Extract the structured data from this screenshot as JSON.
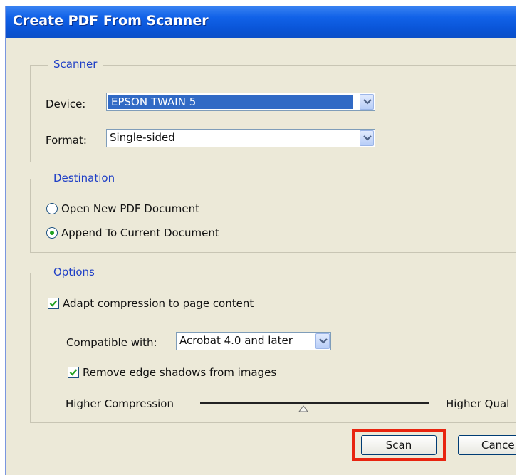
{
  "window": {
    "title": "Create PDF From Scanner"
  },
  "scanner": {
    "legend": "Scanner",
    "device_label": "Device:",
    "device_value": "EPSON TWAIN 5",
    "format_label": "Format:",
    "format_value": "Single-sided"
  },
  "destination": {
    "legend": "Destination",
    "options": [
      {
        "label": "Open New PDF Document",
        "selected": false
      },
      {
        "label": "Append To Current Document",
        "selected": true
      }
    ]
  },
  "options": {
    "legend": "Options",
    "adapt_compression": {
      "label": "Adapt compression to page content",
      "checked": true
    },
    "compatible_label": "Compatible with:",
    "compatible_value": "Acrobat 4.0 and later",
    "remove_shadows": {
      "label": "Remove edge shadows from images",
      "checked": true
    },
    "slider": {
      "left_label": "Higher Compression",
      "right_label": "Higher Qual",
      "value": 0.45
    }
  },
  "buttons": {
    "scan": "Scan",
    "cancel": "Cance"
  },
  "colors": {
    "highlight": "#e8240f",
    "titlebar": "#0a55d8",
    "legend_text": "#1f3fc6"
  }
}
